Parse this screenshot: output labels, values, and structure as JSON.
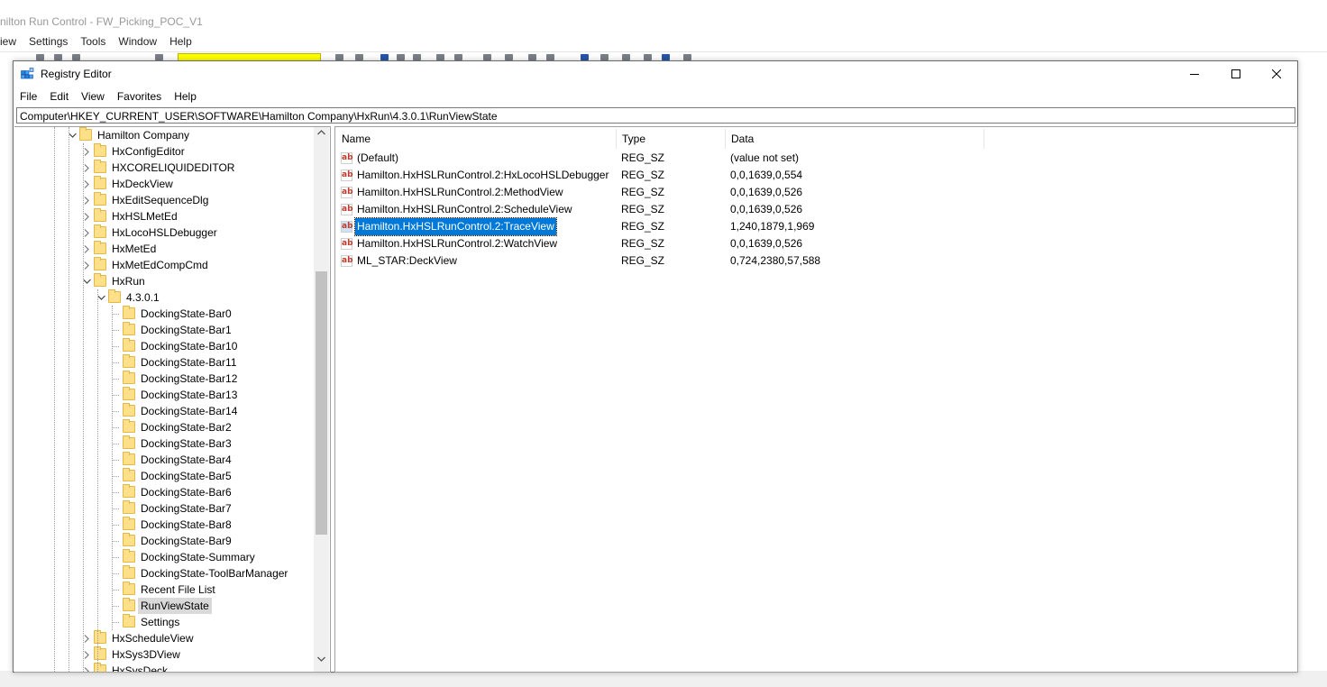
{
  "background_window": {
    "title": "nilton Run Control - FW_Picking_POC_V1",
    "menu": [
      "iew",
      "Settings",
      "Tools",
      "Window",
      "Help"
    ]
  },
  "window": {
    "title": "Registry Editor",
    "menu": [
      "File",
      "Edit",
      "View",
      "Favorites",
      "Help"
    ],
    "address": "Computer\\HKEY_CURRENT_USER\\SOFTWARE\\Hamilton Company\\HxRun\\4.3.0.1\\RunViewState"
  },
  "tree": {
    "items": [
      {
        "label": "Hamilton Company",
        "level": 0,
        "state": "expanded"
      },
      {
        "label": "HxConfigEditor",
        "level": 1,
        "state": "collapsed"
      },
      {
        "label": "HXCORELIQUIDEDITOR",
        "level": 1,
        "state": "collapsed"
      },
      {
        "label": "HxDeckView",
        "level": 1,
        "state": "collapsed"
      },
      {
        "label": "HxEditSequenceDlg",
        "level": 1,
        "state": "collapsed"
      },
      {
        "label": "HxHSLMetEd",
        "level": 1,
        "state": "collapsed"
      },
      {
        "label": "HxLocoHSLDebugger",
        "level": 1,
        "state": "collapsed"
      },
      {
        "label": "HxMetEd",
        "level": 1,
        "state": "collapsed"
      },
      {
        "label": "HxMetEdCompCmd",
        "level": 1,
        "state": "collapsed"
      },
      {
        "label": "HxRun",
        "level": 1,
        "state": "expanded"
      },
      {
        "label": "4.3.0.1",
        "level": 2,
        "state": "expanded"
      },
      {
        "label": "DockingState-Bar0",
        "level": 3,
        "state": "leaf"
      },
      {
        "label": "DockingState-Bar1",
        "level": 3,
        "state": "leaf"
      },
      {
        "label": "DockingState-Bar10",
        "level": 3,
        "state": "leaf"
      },
      {
        "label": "DockingState-Bar11",
        "level": 3,
        "state": "leaf"
      },
      {
        "label": "DockingState-Bar12",
        "level": 3,
        "state": "leaf"
      },
      {
        "label": "DockingState-Bar13",
        "level": 3,
        "state": "leaf"
      },
      {
        "label": "DockingState-Bar14",
        "level": 3,
        "state": "leaf"
      },
      {
        "label": "DockingState-Bar2",
        "level": 3,
        "state": "leaf"
      },
      {
        "label": "DockingState-Bar3",
        "level": 3,
        "state": "leaf"
      },
      {
        "label": "DockingState-Bar4",
        "level": 3,
        "state": "leaf"
      },
      {
        "label": "DockingState-Bar5",
        "level": 3,
        "state": "leaf"
      },
      {
        "label": "DockingState-Bar6",
        "level": 3,
        "state": "leaf"
      },
      {
        "label": "DockingState-Bar7",
        "level": 3,
        "state": "leaf"
      },
      {
        "label": "DockingState-Bar8",
        "level": 3,
        "state": "leaf"
      },
      {
        "label": "DockingState-Bar9",
        "level": 3,
        "state": "leaf"
      },
      {
        "label": "DockingState-Summary",
        "level": 3,
        "state": "leaf"
      },
      {
        "label": "DockingState-ToolBarManager",
        "level": 3,
        "state": "leaf"
      },
      {
        "label": "Recent File List",
        "level": 3,
        "state": "leaf"
      },
      {
        "label": "RunViewState",
        "level": 3,
        "state": "leaf",
        "selected": true
      },
      {
        "label": "Settings",
        "level": 3,
        "state": "leaf"
      },
      {
        "label": "HxScheduleView",
        "level": 1,
        "state": "collapsed"
      },
      {
        "label": "HxSys3DView",
        "level": 1,
        "state": "collapsed"
      },
      {
        "label": "HxSysDeck",
        "level": 1,
        "state": "collapsed"
      }
    ]
  },
  "values": {
    "columns": [
      "Name",
      "Type",
      "Data"
    ],
    "rows": [
      {
        "name": "(Default)",
        "type": "REG_SZ",
        "data": "(value not set)"
      },
      {
        "name": "Hamilton.HxHSLRunControl.2:HxLocoHSLDebugger",
        "type": "REG_SZ",
        "data": "0,0,1639,0,554"
      },
      {
        "name": "Hamilton.HxHSLRunControl.2:MethodView",
        "type": "REG_SZ",
        "data": "0,0,1639,0,526"
      },
      {
        "name": "Hamilton.HxHSLRunControl.2:ScheduleView",
        "type": "REG_SZ",
        "data": "0,0,1639,0,526"
      },
      {
        "name": "Hamilton.HxHSLRunControl.2:TraceView",
        "type": "REG_SZ",
        "data": "1,240,1879,1,969",
        "selected": true
      },
      {
        "name": "Hamilton.HxHSLRunControl.2:WatchView",
        "type": "REG_SZ",
        "data": "0,0,1639,0,526"
      },
      {
        "name": "ML_STAR:DeckView",
        "type": "REG_SZ",
        "data": "0,724,2380,57,588"
      }
    ],
    "icon": "string-value-icon",
    "icon_text": "ab"
  },
  "colors": {
    "selection": "#0078d7",
    "tree_selection": "#d9d9d9",
    "folder": "#ffe08a",
    "toolbar_highlight": "#ffff00"
  }
}
